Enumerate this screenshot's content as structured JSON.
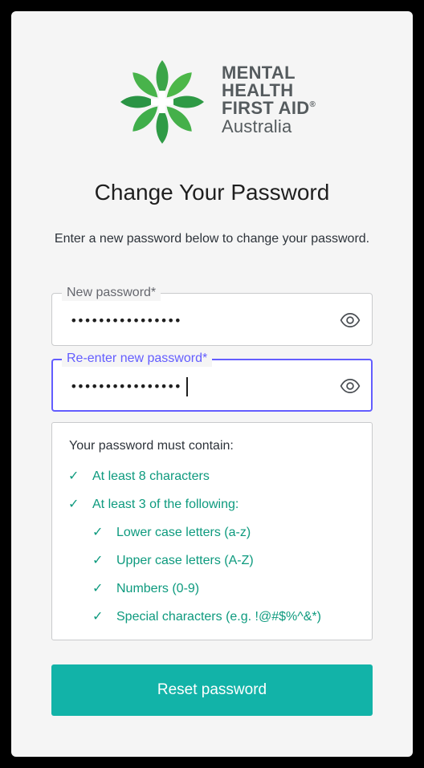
{
  "logo": {
    "line1": "MENTAL",
    "line2": "HEALTH",
    "line3": "FIRST AID",
    "registered": "®",
    "line4": "Australia"
  },
  "title": "Change Your Password",
  "description": "Enter a new password below to change your password.",
  "fields": {
    "new_password": {
      "label": "New password*",
      "value": "••••••••••••••••",
      "icon": "eye-icon"
    },
    "reenter_password": {
      "label": "Re-enter new password*",
      "value": "••••••••••••••••",
      "icon": "eye-icon",
      "focused": true
    }
  },
  "requirements": {
    "title": "Your password must contain:",
    "items": [
      {
        "check": "✓",
        "label": "At least 8 characters"
      },
      {
        "check": "✓",
        "label": "At least 3 of the following:"
      }
    ],
    "sub_items": [
      {
        "check": "✓",
        "label": "Lower case letters (a-z)"
      },
      {
        "check": "✓",
        "label": "Upper case letters (A-Z)"
      },
      {
        "check": "✓",
        "label": "Numbers (0-9)"
      },
      {
        "check": "✓",
        "label": "Special characters (e.g. !@#$%^&*)"
      }
    ]
  },
  "submit_label": "Reset password",
  "colors": {
    "accent": "#635dff",
    "success": "#0d9a7e",
    "button": "#12b3a8",
    "logo_green": "#2ea84a"
  }
}
